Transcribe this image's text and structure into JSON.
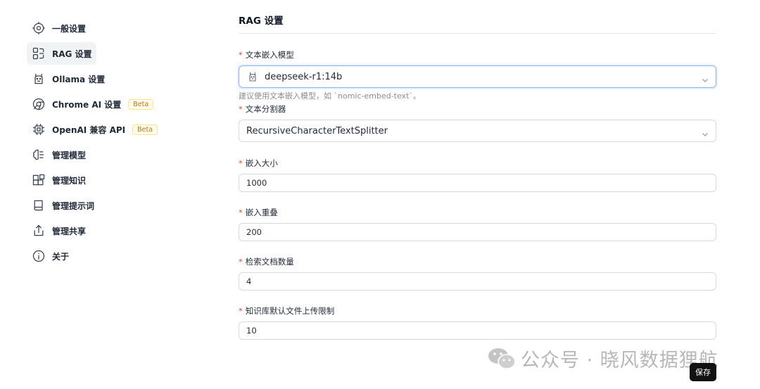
{
  "sidebar": {
    "items": [
      {
        "label": "一般设置",
        "icon": "settings-cog-icon"
      },
      {
        "label": "RAG 设置",
        "icon": "rag-icon",
        "active": true
      },
      {
        "label": "Ollama 设置",
        "icon": "llama-icon"
      },
      {
        "label": "Chrome AI 设置",
        "icon": "chrome-icon",
        "badge": "Beta"
      },
      {
        "label": "OpenAI 兼容 API",
        "icon": "cpu-chip-icon",
        "badge": "Beta"
      },
      {
        "label": "管理模型",
        "icon": "brain-icon"
      },
      {
        "label": "管理知识",
        "icon": "blocks-icon"
      },
      {
        "label": "管理提示词",
        "icon": "book-icon"
      },
      {
        "label": "管理共享",
        "icon": "share-icon"
      },
      {
        "label": "关于",
        "icon": "info-icon"
      }
    ]
  },
  "main": {
    "title": "RAG 设置",
    "fields": {
      "embedding_model": {
        "label": "文本嵌入模型",
        "required_mark": "*",
        "value": "deepseek-r1:14b",
        "help": "建议使用文本嵌入模型，如 `nomic-embed-text`。"
      },
      "splitter": {
        "label": "文本分割器",
        "required_mark": "*",
        "value": "RecursiveCharacterTextSplitter"
      },
      "chunk_size": {
        "label": "嵌入大小",
        "required_mark": "*",
        "value": "1000"
      },
      "chunk_overlap": {
        "label": "嵌入重叠",
        "required_mark": "*",
        "value": "200"
      },
      "retrieval_count": {
        "label": "检索文档数量",
        "required_mark": "*",
        "value": "4"
      },
      "upload_limit": {
        "label": "知识库默认文件上传限制",
        "required_mark": "*",
        "value": "10"
      }
    },
    "save_label": "保存"
  },
  "watermark": {
    "text": "公众号 · 晓风数据狸航"
  },
  "colors": {
    "required": "#ef4444",
    "badge_text": "#b7791f",
    "badge_bg": "#fefce8",
    "focus_border": "#8fb4f5",
    "save_bg": "#111111"
  }
}
